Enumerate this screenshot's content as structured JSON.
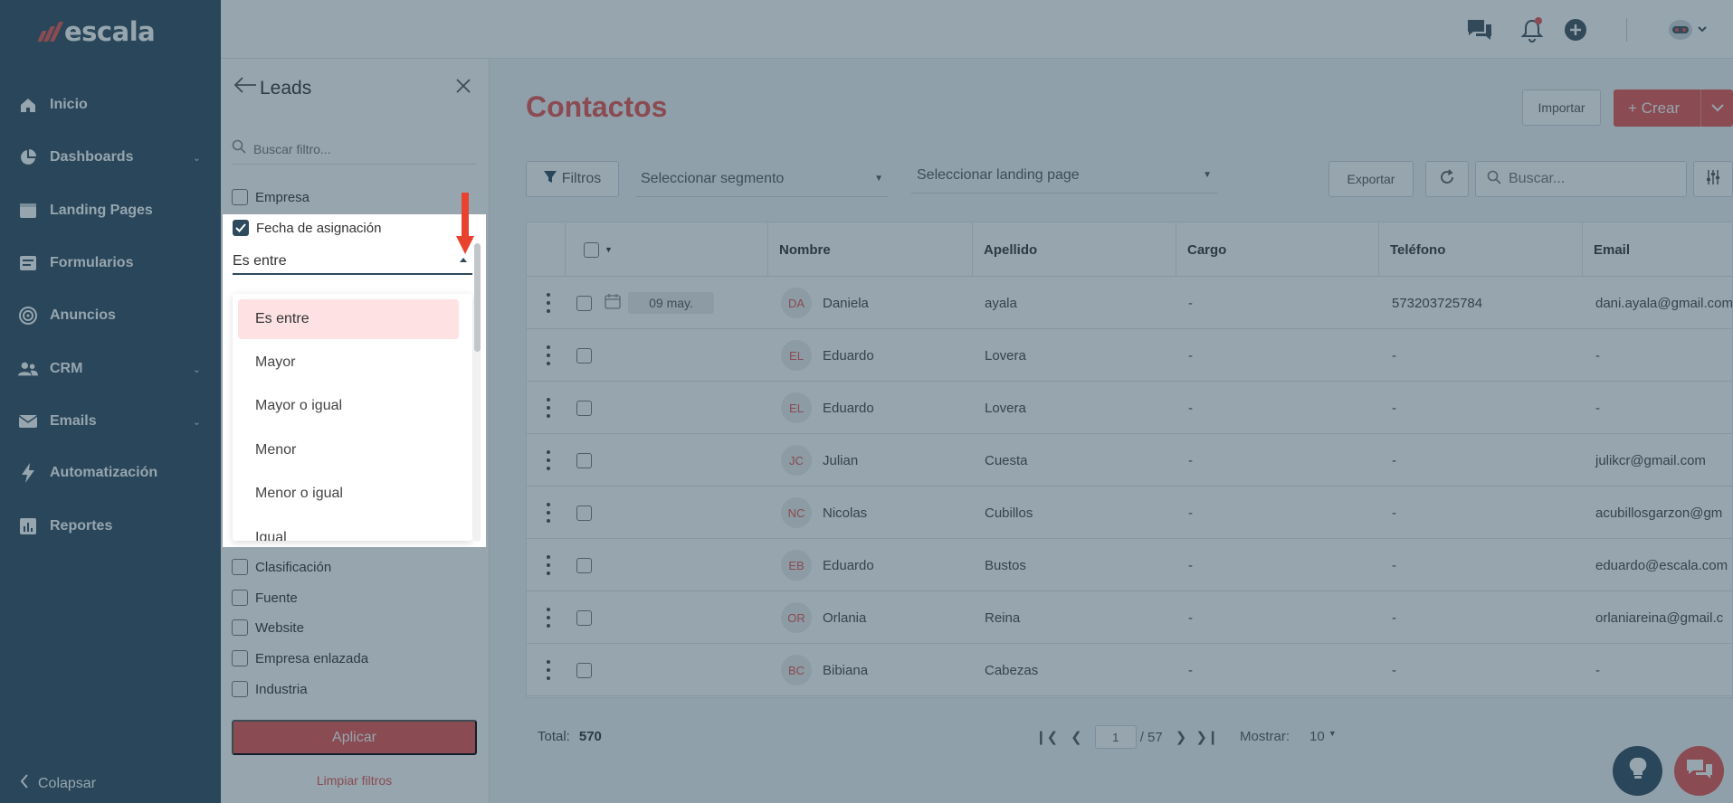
{
  "brand": {
    "name": "escala",
    "trademark": "™"
  },
  "sidebar": {
    "items": [
      {
        "label": "Inicio",
        "icon": "home-icon",
        "has_chevron": false
      },
      {
        "label": "Dashboards",
        "icon": "pie-chart-icon",
        "has_chevron": true
      },
      {
        "label": "Landing Pages",
        "icon": "window-icon",
        "has_chevron": false
      },
      {
        "label": "Formularios",
        "icon": "form-icon",
        "has_chevron": false
      },
      {
        "label": "Anuncios",
        "icon": "target-icon",
        "has_chevron": false
      },
      {
        "label": "CRM",
        "icon": "users-icon",
        "has_chevron": true
      },
      {
        "label": "Emails",
        "icon": "envelope-icon",
        "has_chevron": true
      },
      {
        "label": "Automatización",
        "icon": "bolt-icon",
        "has_chevron": false
      },
      {
        "label": "Reportes",
        "icon": "report-icon",
        "has_chevron": false
      }
    ],
    "collapse_label": "Colapsar"
  },
  "header": {
    "icons": [
      "chat-icon",
      "bell-icon",
      "plus-circle-icon",
      "robot-avatar-icon"
    ]
  },
  "main": {
    "title": "Contactos",
    "import_label": "Importar",
    "create_label": "+ Crear",
    "filters_label": "Filtros",
    "segment_placeholder": "Seleccionar segmento",
    "landing_placeholder": "Seleccionar landing page",
    "export_label": "Exportar",
    "search_placeholder": "Buscar..."
  },
  "table": {
    "columns": [
      "Nombre",
      "Apellido",
      "Cargo",
      "Teléfono",
      "Email"
    ],
    "rows": [
      {
        "initials": "DA",
        "nombre": "Daniela",
        "apellido": "ayala",
        "cargo": "-",
        "telefono": "573203725784",
        "email": "dani.ayala@gmail.com",
        "date": "09 may."
      },
      {
        "initials": "EL",
        "nombre": "Eduardo",
        "apellido": "Lovera",
        "cargo": "-",
        "telefono": "-",
        "email": "-"
      },
      {
        "initials": "EL",
        "nombre": "Eduardo",
        "apellido": "Lovera",
        "cargo": "-",
        "telefono": "-",
        "email": "-"
      },
      {
        "initials": "JC",
        "nombre": "Julian",
        "apellido": "Cuesta",
        "cargo": "-",
        "telefono": "-",
        "email": "julikcr@gmail.com"
      },
      {
        "initials": "NC",
        "nombre": "Nicolas",
        "apellido": "Cubillos",
        "cargo": "-",
        "telefono": "-",
        "email": "acubillosgarzon@gm"
      },
      {
        "initials": "EB",
        "nombre": "Eduardo",
        "apellido": "Bustos",
        "cargo": "-",
        "telefono": "-",
        "email": "eduardo@escala.com"
      },
      {
        "initials": "OR",
        "nombre": "Orlania",
        "apellido": "Reina",
        "cargo": "-",
        "telefono": "-",
        "email": "orlaniareina@gmail.c"
      },
      {
        "initials": "BC",
        "nombre": "Bibiana",
        "apellido": "Cabezas",
        "cargo": "-",
        "telefono": "-",
        "email": "-"
      }
    ]
  },
  "footer": {
    "total_label": "Total:",
    "total_value": "570",
    "current_page": "1",
    "total_pages": "/ 57",
    "show_label": "Mostrar:",
    "show_value": "10"
  },
  "filter_panel": {
    "title": "Leads",
    "search_placeholder": "Buscar filtro...",
    "options_top": [
      {
        "label": "Empresa",
        "checked": false
      }
    ],
    "active_option": {
      "label": "Fecha de asignación",
      "checked": true
    },
    "operator_selected": "Es entre",
    "operator_options": [
      "Es entre",
      "Mayor",
      "Mayor o igual",
      "Menor",
      "Menor o igual",
      "Igual"
    ],
    "options_bottom": [
      {
        "label": "Clasificación",
        "checked": false
      },
      {
        "label": "Fuente",
        "checked": false
      },
      {
        "label": "Website",
        "checked": false
      },
      {
        "label": "Empresa enlazada",
        "checked": false
      },
      {
        "label": "Industria",
        "checked": false
      }
    ],
    "apply_label": "Aplicar",
    "clear_label": "Limpiar filtros"
  },
  "colors": {
    "brand": "#e8534f",
    "sidebar": "#2e4a5e",
    "selected_option": "#fde1e3",
    "annotation_arrow": "#e8432f"
  }
}
